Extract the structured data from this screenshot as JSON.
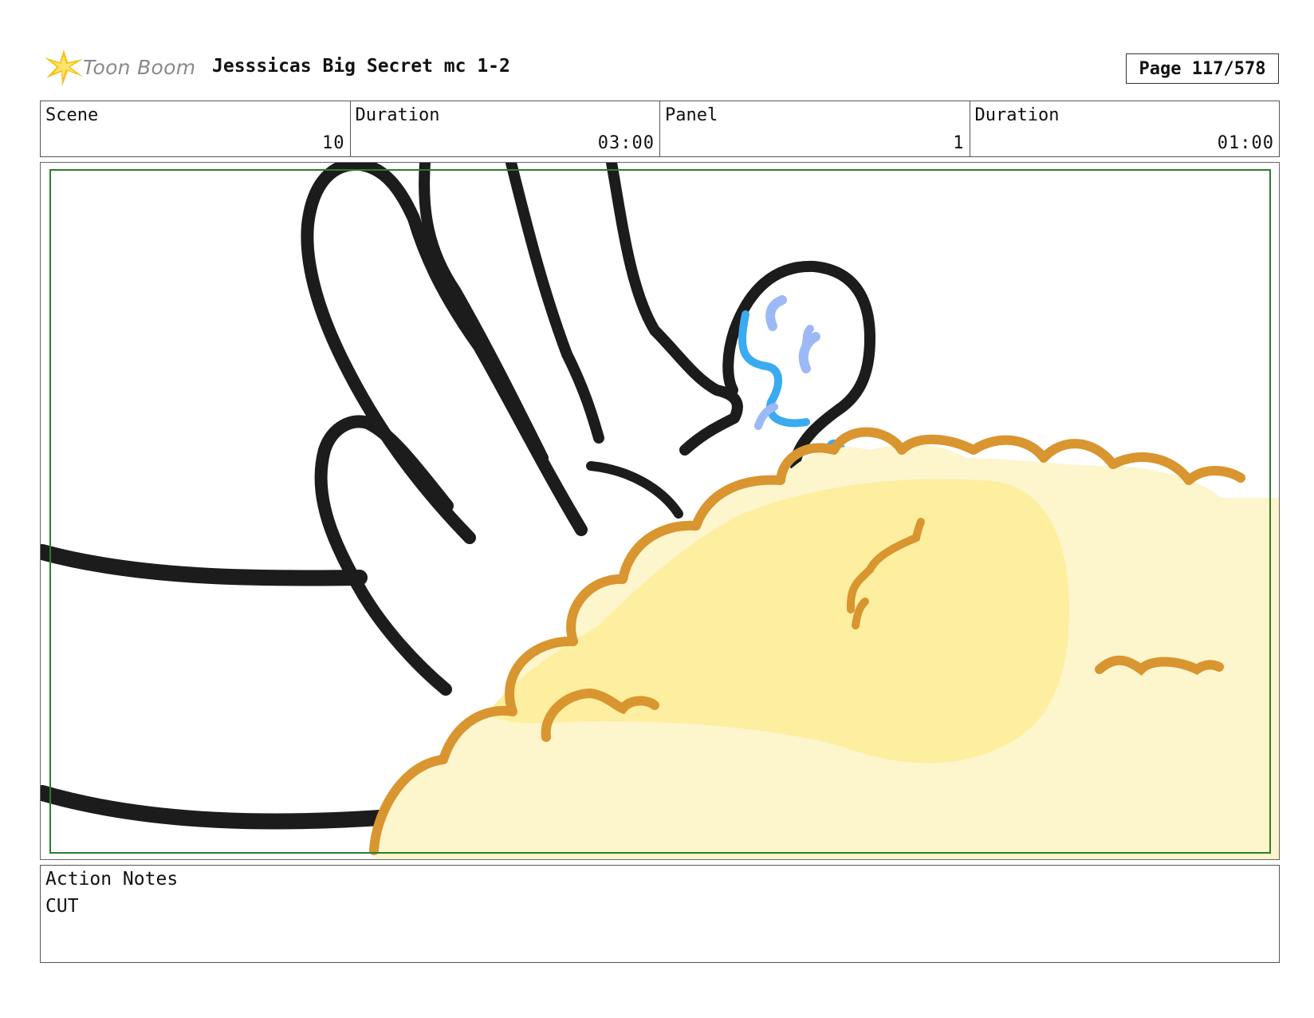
{
  "header": {
    "brand": "Toon Boom",
    "title": "Jesssicas Big Secret mc 1-2",
    "page": "Page 117/578"
  },
  "info": {
    "scene_label": "Scene",
    "scene_value": "10",
    "scene_duration_label": "Duration",
    "scene_duration_value": "03:00",
    "panel_label": "Panel",
    "panel_value": "1",
    "panel_duration_label": "Duration",
    "panel_duration_value": "01:00"
  },
  "notes": {
    "label": "Action Notes",
    "text": "CUT"
  },
  "colors": {
    "outline": "#1c1c1c",
    "cloud_fill": "#fdf0a6",
    "cloud_outline": "#d9952f",
    "sweat_blue": "#3aabf0",
    "sweat_light": "#9db9f5",
    "safe_frame": "#2e7d2e"
  }
}
